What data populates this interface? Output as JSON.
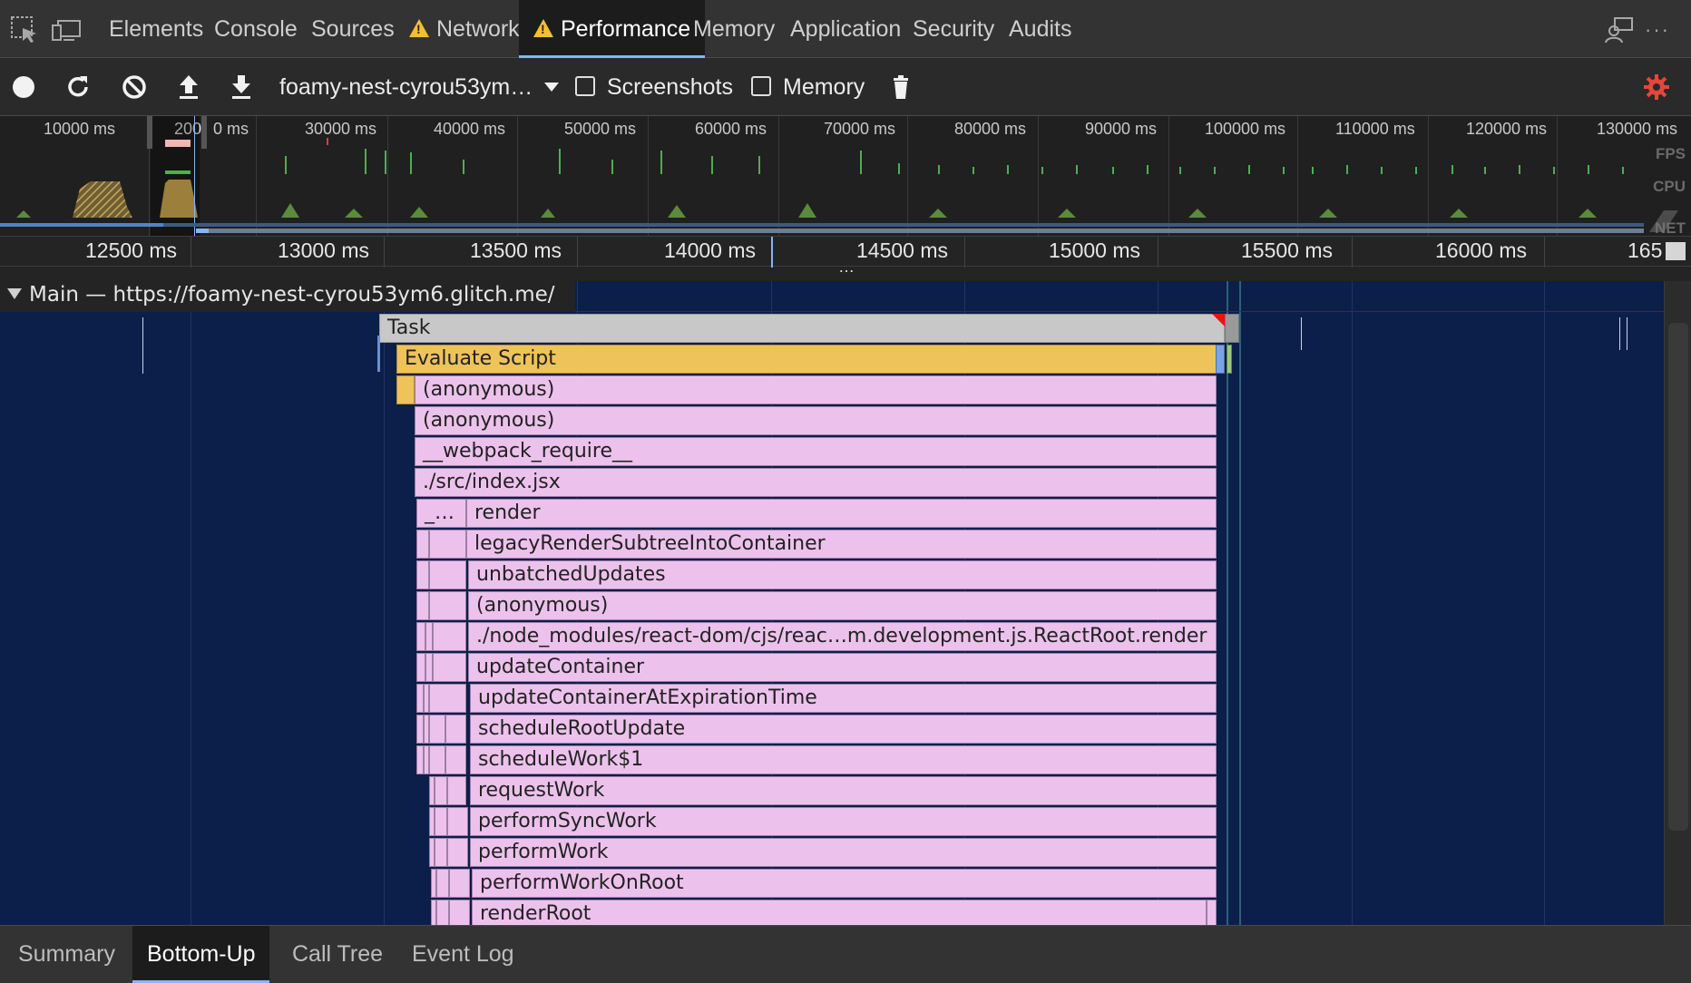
{
  "tabs": [
    {
      "label": "Elements",
      "warning": false
    },
    {
      "label": "Console",
      "warning": false
    },
    {
      "label": "Sources",
      "warning": false
    },
    {
      "label": "Network",
      "warning": true
    },
    {
      "label": "Performance",
      "warning": true,
      "active": true
    },
    {
      "label": "Memory",
      "warning": false
    },
    {
      "label": "Application",
      "warning": false
    },
    {
      "label": "Security",
      "warning": false
    },
    {
      "label": "Audits",
      "warning": false
    }
  ],
  "toolbar": {
    "profile_select": "foamy-nest-cyrou53ym…",
    "screenshots_label": "Screenshots",
    "memory_label": "Memory",
    "screenshots_checked": false,
    "memory_checked": false
  },
  "overview": {
    "time_labels": [
      "10000 ms",
      "200",
      "0 ms",
      "30000 ms",
      "40000 ms",
      "50000 ms",
      "60000 ms",
      "70000 ms",
      "80000 ms",
      "90000 ms",
      "100000 ms",
      "110000 ms",
      "120000 ms",
      "130000 ms"
    ],
    "side_labels": {
      "fps": "FPS",
      "cpu": "CPU",
      "net": "NET"
    }
  },
  "ruler": {
    "labels": [
      "12500 ms",
      "13000 ms",
      "13500 ms",
      "14000 ms",
      "14500 ms",
      "15000 ms",
      "15500 ms",
      "16000 ms",
      "165"
    ]
  },
  "main_track": {
    "title": "Main — https://foamy-nest-cyrou53ym6.glitch.me/",
    "handle": "…"
  },
  "flame": {
    "task": "Task",
    "evaluate": "Evaluate Script",
    "frames": [
      "(anonymous)",
      "(anonymous)",
      "__webpack_require__",
      "./src/index.jsx",
      "render",
      "legacyRenderSubtreeIntoContainer",
      "unbatchedUpdates",
      "(anonymous)",
      "./node_modules/react-dom/cjs/reac…m.development.js.ReactRoot.render",
      "updateContainer",
      "updateContainerAtExpirationTime",
      "scheduleRootUpdate",
      "scheduleWork$1",
      "requestWork",
      "performSyncWork",
      "performWork",
      "performWorkOnRoot",
      "renderRoot"
    ],
    "truncated_label": "_…"
  },
  "bottom_tabs": [
    {
      "label": "Summary"
    },
    {
      "label": "Bottom-Up",
      "active": true
    },
    {
      "label": "Call Tree"
    },
    {
      "label": "Event Log"
    }
  ],
  "colors": {
    "accent": "#8ab4f8",
    "flame_bg": "#0b1f4a",
    "js_frame": "#ecc2ec",
    "script_eval": "#eec35a",
    "task": "#c8c8c8",
    "record_settings": "#e8453c"
  },
  "icons": {
    "inspect": "inspect-element-icon",
    "device": "device-toolbar-icon",
    "record": "record-icon",
    "reload": "reload-icon",
    "clear": "clear-icon",
    "upload": "load-profile-icon",
    "download": "save-profile-icon",
    "dropdown": "dropdown-arrow-icon",
    "trash": "collect-garbage-icon",
    "settings": "capture-settings-icon",
    "feedback": "feedback-icon",
    "more": "more-options-icon"
  }
}
